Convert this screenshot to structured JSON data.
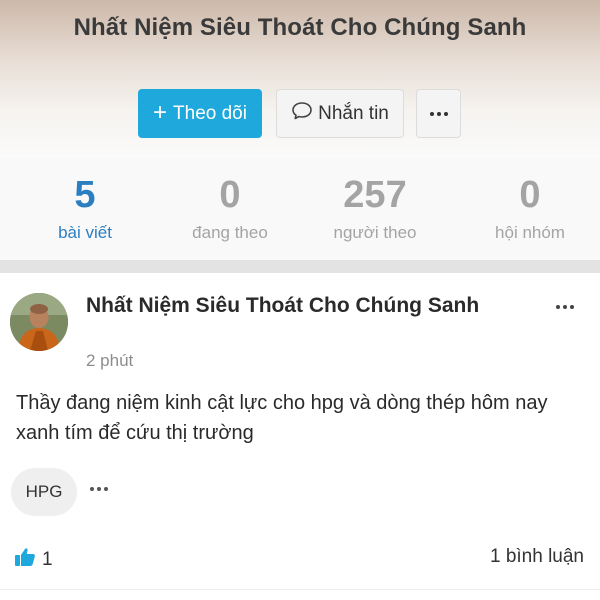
{
  "profile": {
    "title": "Nhất Niệm Siêu Thoát Cho Chúng Sanh",
    "follow_label": "Theo dõi",
    "message_label": "Nhắn tin"
  },
  "stats": [
    {
      "value": "5",
      "label": "bài viết",
      "active": true
    },
    {
      "value": "0",
      "label": "đang theo",
      "active": false
    },
    {
      "value": "257",
      "label": "người theo",
      "active": false
    },
    {
      "value": "0",
      "label": "hội nhóm",
      "active": false
    }
  ],
  "post": {
    "author": "Nhất Niệm Siêu Thoát Cho Chúng Sanh",
    "time": "2 phút",
    "body": "Thầy đang niệm kinh cật lực cho hpg và dòng thép hôm nay xanh tím để cứu thị trường",
    "tag": "HPG",
    "likes": "1",
    "comments": "1 bình luận"
  },
  "colors": {
    "accent": "#1fa8db",
    "active_stat": "#2b7fc1",
    "like_icon": "#1fa8db"
  },
  "icons": {
    "follow": "plus-icon",
    "message": "chat-bubble-icon",
    "more": "more-dots-icon",
    "like": "thumbs-up-icon"
  }
}
